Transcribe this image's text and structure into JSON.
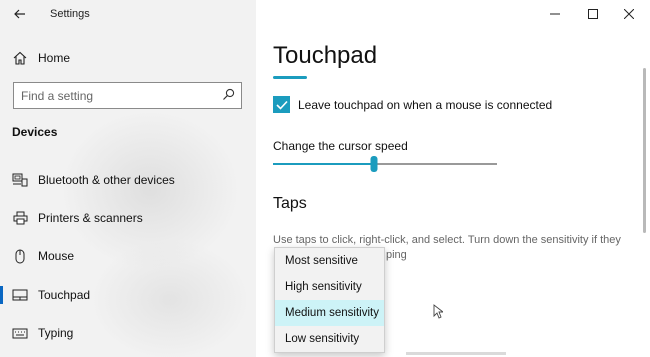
{
  "window": {
    "title": "Settings"
  },
  "sidebar": {
    "home_label": "Home",
    "search_placeholder": "Find a setting",
    "section_title": "Devices",
    "items": [
      {
        "label": "Bluetooth & other devices",
        "icon": "bluetooth-devices-icon"
      },
      {
        "label": "Printers & scanners",
        "icon": "printer-icon"
      },
      {
        "label": "Mouse",
        "icon": "mouse-icon"
      },
      {
        "label": "Touchpad",
        "icon": "touchpad-icon",
        "selected": true
      },
      {
        "label": "Typing",
        "icon": "keyboard-icon"
      }
    ]
  },
  "main": {
    "title": "Touchpad",
    "keep_on_label": "Leave touchpad on when a mouse is connected",
    "keep_on_checked": true,
    "cursor_speed_label": "Change the cursor speed",
    "cursor_speed_fraction": 0.45,
    "taps_heading": "Taps",
    "taps_description": "Use taps to click, right-click, and select. Turn down the sensitivity if they",
    "taps_description_tail": "ping",
    "sensitivity_options": [
      "Most sensitive",
      "High sensitivity",
      "Medium sensitivity",
      "Low sensitivity"
    ],
    "sensitivity_selected": "Medium sensitivity"
  },
  "colors": {
    "accent": "#1b9cbe",
    "selected_bar": "#0a67c2",
    "sidebar_bg": "#f2f2f2",
    "dropdown_highlight": "#cdf3f7"
  }
}
